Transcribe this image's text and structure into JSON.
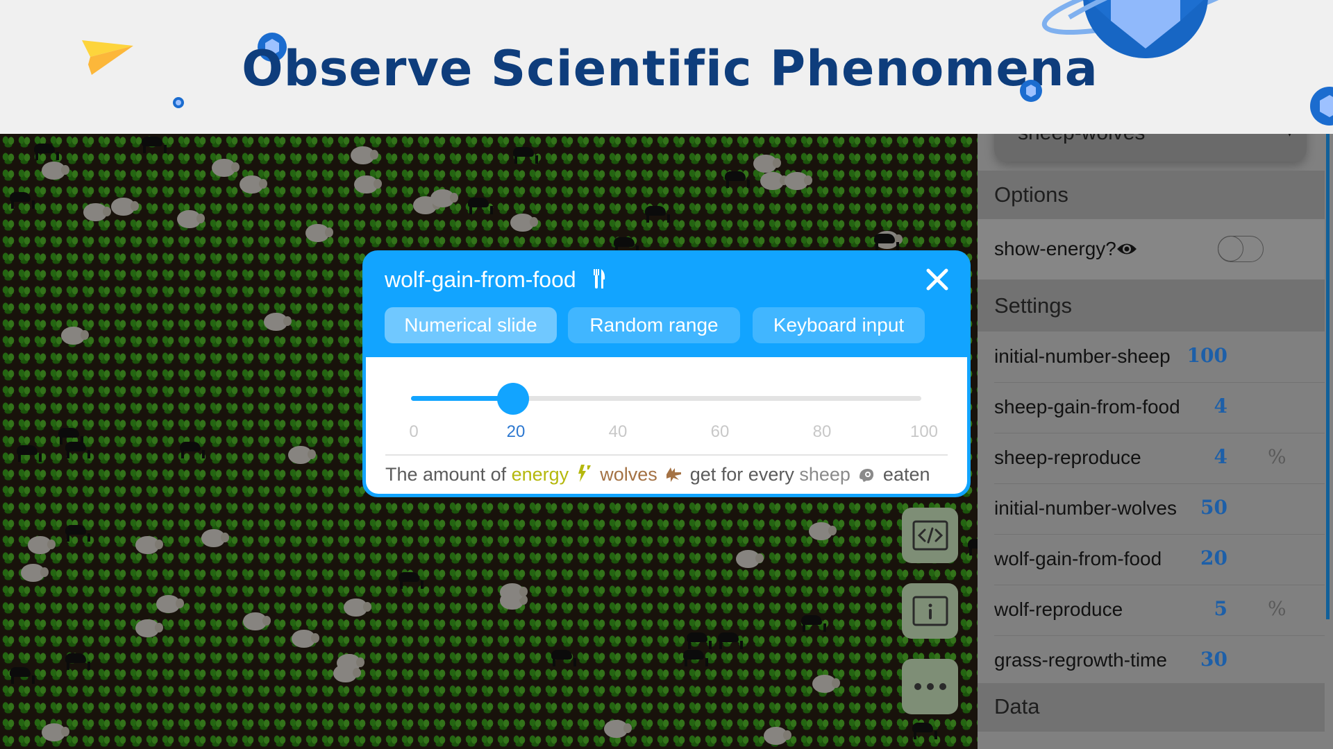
{
  "header": {
    "title": "Observe Scientific Phenomena"
  },
  "world": {
    "agents": [
      "sheep",
      "wolves",
      "grass"
    ]
  },
  "sidebar": {
    "model_dropdown": {
      "selected": "sheep-wolves"
    },
    "options": {
      "title": "Options",
      "show_energy": {
        "label": "show-energy?",
        "icon": "eye-icon",
        "checked": false
      }
    },
    "settings": {
      "title": "Settings",
      "items": [
        {
          "label": "initial-number-sheep",
          "value": "100",
          "unit": ""
        },
        {
          "label": "sheep-gain-from-food",
          "value": "4",
          "unit": ""
        },
        {
          "label": "sheep-reproduce",
          "value": "4",
          "unit": "%"
        },
        {
          "label": "initial-number-wolves",
          "value": "50",
          "unit": ""
        },
        {
          "label": "wolf-gain-from-food",
          "value": "20",
          "unit": ""
        },
        {
          "label": "wolf-reproduce",
          "value": "5",
          "unit": "%"
        },
        {
          "label": "grass-regrowth-time",
          "value": "30",
          "unit": ""
        }
      ]
    },
    "data_section": {
      "title": "Data"
    }
  },
  "floating_buttons": [
    {
      "name": "code-button",
      "icon": "code-icon"
    },
    {
      "name": "info-button",
      "icon": "info-icon"
    },
    {
      "name": "more-button",
      "icon": "more-dots-icon"
    }
  ],
  "modal": {
    "title": "wolf-gain-from-food",
    "title_icon": "fork-knife-icon",
    "tabs": [
      {
        "label": "Numerical slide",
        "active": true
      },
      {
        "label": "Random range",
        "active": false
      },
      {
        "label": "Keyboard input",
        "active": false
      }
    ],
    "slider": {
      "min": 0,
      "max": 100,
      "value": 20,
      "ticks": [
        "0",
        "20",
        "40",
        "60",
        "80",
        "100"
      ]
    },
    "description": {
      "part1": "The amount of ",
      "energy": "energy",
      "wolves": "wolves",
      "part2": " get for every ",
      "sheep": "sheep",
      "part3": " eaten"
    }
  },
  "colors": {
    "accent": "#12a4ff",
    "title_navy": "#0e3d7c",
    "value_blue": "#1d5fa8",
    "energy": "#b5b80d",
    "wolves": "#a47244"
  }
}
